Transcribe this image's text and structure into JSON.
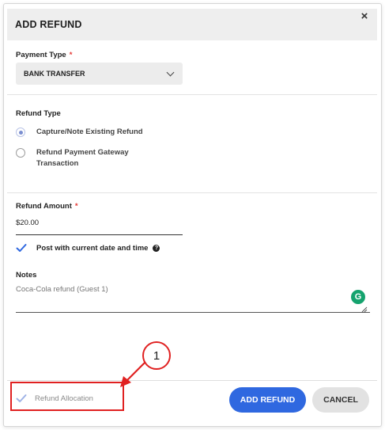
{
  "dialog": {
    "title": "ADD REFUND",
    "close_glyph": "×"
  },
  "payment_type": {
    "label": "Payment Type",
    "required_mark": "*",
    "selected": "BANK TRANSFER"
  },
  "refund_type": {
    "label": "Refund Type",
    "options": [
      {
        "label": "Capture/Note Existing Refund",
        "checked": true
      },
      {
        "label": "Refund Payment Gateway Transaction",
        "checked": false
      }
    ]
  },
  "refund_amount": {
    "label": "Refund Amount",
    "required_mark": "*",
    "value": "$20.00"
  },
  "post_current": {
    "label": "Post with current date and time",
    "checked": true,
    "help_glyph": "?"
  },
  "notes": {
    "label": "Notes",
    "value": "Coca-Cola refund (Guest 1)"
  },
  "footer": {
    "allocation_label": "Refund Allocation",
    "allocation_checked": true,
    "add_button": "ADD REFUND",
    "cancel_button": "CANCEL"
  },
  "annotation": {
    "callout_number": "1"
  },
  "colors": {
    "primary": "#2f68e0",
    "check": "#2f68e0",
    "required": "#e53935",
    "annotation": "#e02121",
    "grammarly": "#15a36e"
  },
  "icons": {
    "close": "close-icon",
    "dropdown": "chevron-down-icon",
    "check": "checkmark-icon",
    "help": "help-icon",
    "grammarly": "grammarly-icon",
    "resize": "resize-handle-icon"
  }
}
